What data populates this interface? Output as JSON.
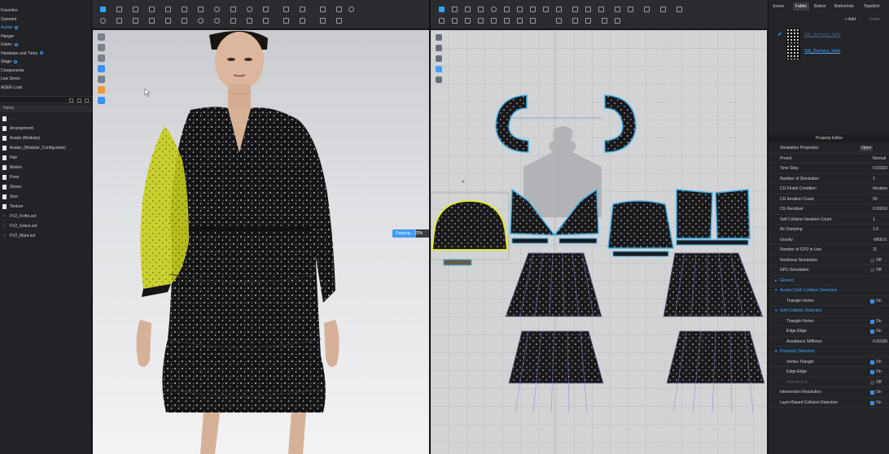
{
  "left_panel": {
    "favorites": [
      {
        "label": "Favorites",
        "active": false
      },
      {
        "label": "Garment",
        "active": false
      },
      {
        "label": "Avatar",
        "active": true
      },
      {
        "label": "Hanger",
        "active": false
      },
      {
        "label": "Fabric",
        "active": false
      },
      {
        "label": "Hardware and Trims",
        "active": false
      },
      {
        "label": "Stage",
        "active": false
      },
      {
        "label": "Components",
        "active": false
      },
      {
        "label": "Live Demo",
        "active": false
      },
      {
        "label": "ADER Look",
        "active": false
      }
    ],
    "column_header": "Name",
    "items": [
      {
        "label": "..",
        "type": "folder"
      },
      {
        "label": "Arrangement",
        "type": "folder"
      },
      {
        "label": "Avatar (Modular)",
        "type": "folder"
      },
      {
        "label": "Avatar_(Modular_Configurator)",
        "type": "folder"
      },
      {
        "label": "Hair",
        "type": "folder"
      },
      {
        "label": "Motion",
        "type": "folder"
      },
      {
        "label": "Pose",
        "type": "folder"
      },
      {
        "label": "Shoes",
        "type": "folder"
      },
      {
        "label": "Size",
        "type": "folder"
      },
      {
        "label": "Texture",
        "type": "folder"
      },
      {
        "label": "FV2_Feifei.avt",
        "type": "avatar"
      },
      {
        "label": "FV2_Grace.avt",
        "type": "avatar"
      },
      {
        "label": "FV2_Mara.avt",
        "type": "avatar"
      }
    ]
  },
  "simulation": {
    "progress_label": "Draping... 22%",
    "progress_fraction": 0.22
  },
  "right_panel": {
    "tabs": [
      {
        "label": "Scene",
        "active": false
      },
      {
        "label": "Fabric",
        "active": true
      },
      {
        "label": "Button",
        "active": false
      },
      {
        "label": "Buttonhole",
        "active": false
      },
      {
        "label": "Topstitch",
        "active": false
      }
    ],
    "add_label": "+ Add",
    "clone_label": "Clone",
    "fabrics": [
      {
        "name": "Silk_Duchess_Satin",
        "checked": true,
        "faded": true
      },
      {
        "name": "Silk_Duchess_Satin",
        "checked": false,
        "faded": false
      }
    ],
    "property_editor_title": "Property Editor",
    "properties": [
      {
        "kind": "row",
        "label": "Simulation Properties",
        "button": "Open"
      },
      {
        "kind": "row",
        "label": "Preset",
        "value": "Normal"
      },
      {
        "kind": "row",
        "label": "Time Step",
        "value": "0.03333"
      },
      {
        "kind": "row",
        "label": "Number of Simulation",
        "value": "1"
      },
      {
        "kind": "row",
        "label": "CG Finish Condition",
        "value": "Iteration"
      },
      {
        "kind": "row",
        "label": "CG Iteration Count",
        "value": "50"
      },
      {
        "kind": "row",
        "label": "CG Residual",
        "value": "0.00010"
      },
      {
        "kind": "row",
        "label": "Self Collision Iteration Count",
        "value": "1"
      },
      {
        "kind": "row",
        "label": "Air Damping",
        "value": "1.0"
      },
      {
        "kind": "row",
        "label": "Gravity",
        "value": "-9800.0"
      },
      {
        "kind": "row",
        "label": "Number of CPU in Use",
        "value": "11"
      },
      {
        "kind": "check",
        "label": "Nonlinear Simulation",
        "value": "Off",
        "on": false
      },
      {
        "kind": "check",
        "label": "GPU Simulation",
        "value": "Off",
        "on": false
      },
      {
        "kind": "group",
        "label": "Ground",
        "arrow": "▸"
      },
      {
        "kind": "group",
        "label": "Avatar-Cloth Collision Detection",
        "arrow": "▾"
      },
      {
        "kind": "subcheck",
        "label": "Triangle-Vertex",
        "value": "On",
        "on": true
      },
      {
        "kind": "group",
        "label": "Self-Collision Detection",
        "arrow": "▾"
      },
      {
        "kind": "subcheck",
        "label": "Triangle-Vertex",
        "value": "On",
        "on": true
      },
      {
        "kind": "subcheck",
        "label": "Edge-Edge",
        "value": "On",
        "on": true
      },
      {
        "kind": "subrow",
        "label": "Avoidance Stiffness",
        "value": "0.00100"
      },
      {
        "kind": "group",
        "label": "Proximity Detection",
        "arrow": "▾"
      },
      {
        "kind": "subcheck",
        "label": "Vertex-Triangle",
        "value": "On",
        "on": true
      },
      {
        "kind": "subcheck",
        "label": "Edge-Edge",
        "value": "On",
        "on": true
      },
      {
        "kind": "subcheck",
        "label": "Intersection",
        "value": "Off",
        "on": false,
        "disabled": true
      },
      {
        "kind": "check",
        "label": "Intersection Resolution",
        "value": "On",
        "on": true
      },
      {
        "kind": "check",
        "label": "Layer-Based Collision Detection",
        "value": "On",
        "on": true
      }
    ]
  },
  "colors": {
    "accent": "#3fa7ff",
    "selected_piece": "#e4ee20",
    "dress": "#151517",
    "skin": "#d8b49a",
    "pattern_outline": "#3fb0e8"
  }
}
